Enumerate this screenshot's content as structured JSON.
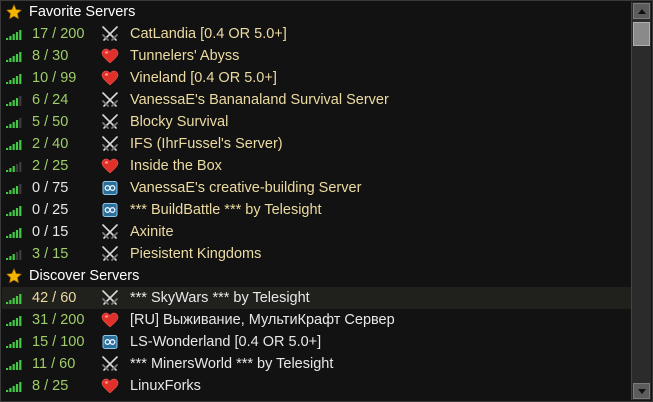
{
  "sections": [
    {
      "title": "Favorite Servers",
      "icon": "star-icon",
      "servers": [
        {
          "players": "17 / 200",
          "name": "CatLandia [0.4 OR 5.0+]",
          "type": "swords-icon",
          "ping": 5,
          "name_color": "yellow",
          "player_color": "green"
        },
        {
          "players": "8 / 30",
          "name": "Tunnelers' Abyss",
          "type": "heart-icon",
          "ping": 5,
          "name_color": "yellow",
          "player_color": "green"
        },
        {
          "players": "10 / 99",
          "name": "Vineland [0.4 OR 5.0+]",
          "type": "heart-icon",
          "ping": 5,
          "name_color": "yellow",
          "player_color": "green"
        },
        {
          "players": "6 / 24",
          "name": "VanessaE's Bananaland Survival Server",
          "type": "swords-icon",
          "ping": 4,
          "name_color": "yellow",
          "player_color": "green"
        },
        {
          "players": "5 / 50",
          "name": "Blocky Survival",
          "type": "swords-icon",
          "ping": 4,
          "name_color": "yellow",
          "player_color": "green"
        },
        {
          "players": "2 / 40",
          "name": "IFS (IhrFussel's Server)",
          "type": "swords-icon",
          "ping": 5,
          "name_color": "yellow",
          "player_color": "green"
        },
        {
          "players": "2 / 25",
          "name": "Inside the Box",
          "type": "heart-icon",
          "ping": 3,
          "name_color": "yellow",
          "player_color": "green"
        },
        {
          "players": "0 / 75",
          "name": "VanessaE's creative-building Server",
          "type": "creative-icon",
          "ping": 4,
          "name_color": "yellow",
          "player_color": "white"
        },
        {
          "players": "0 / 25",
          "name": "*** BuildBattle *** by Telesight",
          "type": "creative-icon",
          "ping": 5,
          "name_color": "yellow",
          "player_color": "white"
        },
        {
          "players": "0 / 15",
          "name": "Axinite",
          "type": "swords-icon",
          "ping": 5,
          "name_color": "yellow",
          "player_color": "white"
        },
        {
          "players": "3 / 15",
          "name": "Piesistent Kingdoms",
          "type": "swords-icon",
          "ping": 3,
          "name_color": "yellow",
          "player_color": "green"
        }
      ]
    },
    {
      "title": "Discover Servers",
      "icon": "star-icon",
      "servers": [
        {
          "players": "42 / 60",
          "name": "*** SkyWars *** by Telesight",
          "type": "swords-icon",
          "ping": 5,
          "name_color": "white",
          "player_color": "yellow",
          "selected": true
        },
        {
          "players": "31 / 200",
          "name": "[RU] Выживание, МультиКрафт Сервер",
          "type": "heart-icon",
          "ping": 5,
          "name_color": "white",
          "player_color": "green"
        },
        {
          "players": "15 / 100",
          "name": "LS-Wonderland [0.4 OR 5.0+]",
          "type": "creative-icon",
          "ping": 5,
          "name_color": "white",
          "player_color": "green"
        },
        {
          "players": "11 / 60",
          "name": "*** MinersWorld *** by Telesight",
          "type": "swords-icon",
          "ping": 5,
          "name_color": "white",
          "player_color": "green"
        },
        {
          "players": "8 / 25",
          "name": "LinuxForks",
          "type": "heart-icon",
          "ping": 5,
          "name_color": "white",
          "player_color": "green"
        }
      ]
    }
  ],
  "colors": {
    "green": "#9fcd6a",
    "white": "#e8e8e8",
    "yellow": "#ecdba2",
    "signal_on": "#43c943",
    "signal_off": "#3c3c3c",
    "heart": "#e0302a",
    "star": "#f5b400"
  }
}
